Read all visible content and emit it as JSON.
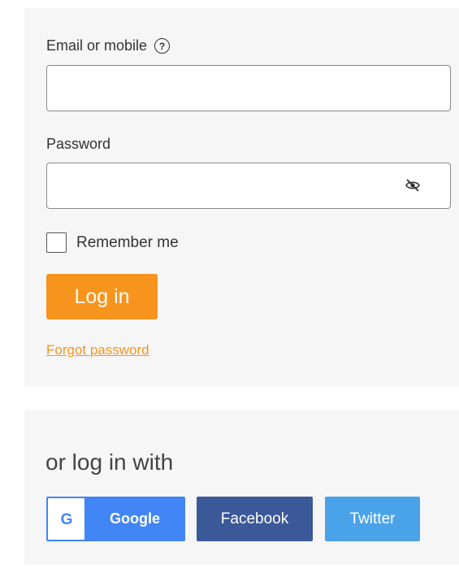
{
  "login": {
    "email_label": "Email or mobile",
    "email_value": "",
    "password_label": "Password",
    "password_value": "",
    "remember_label": "Remember me",
    "remember_checked": false,
    "login_button_label": "Log in",
    "forgot_password_label": "Forgot password"
  },
  "social": {
    "heading": "or log in with",
    "google_label": "Google",
    "google_logo_letter": "G",
    "facebook_label": "Facebook",
    "twitter_label": "Twitter"
  },
  "icons": {
    "help": "question-circle-icon",
    "password_toggle": "eye-slash-icon"
  },
  "colors": {
    "accent": "#f7941d",
    "google": "#4285f4",
    "facebook": "#3b5998",
    "twitter": "#4aa3e8",
    "panel_background": "#f6f6f6"
  }
}
